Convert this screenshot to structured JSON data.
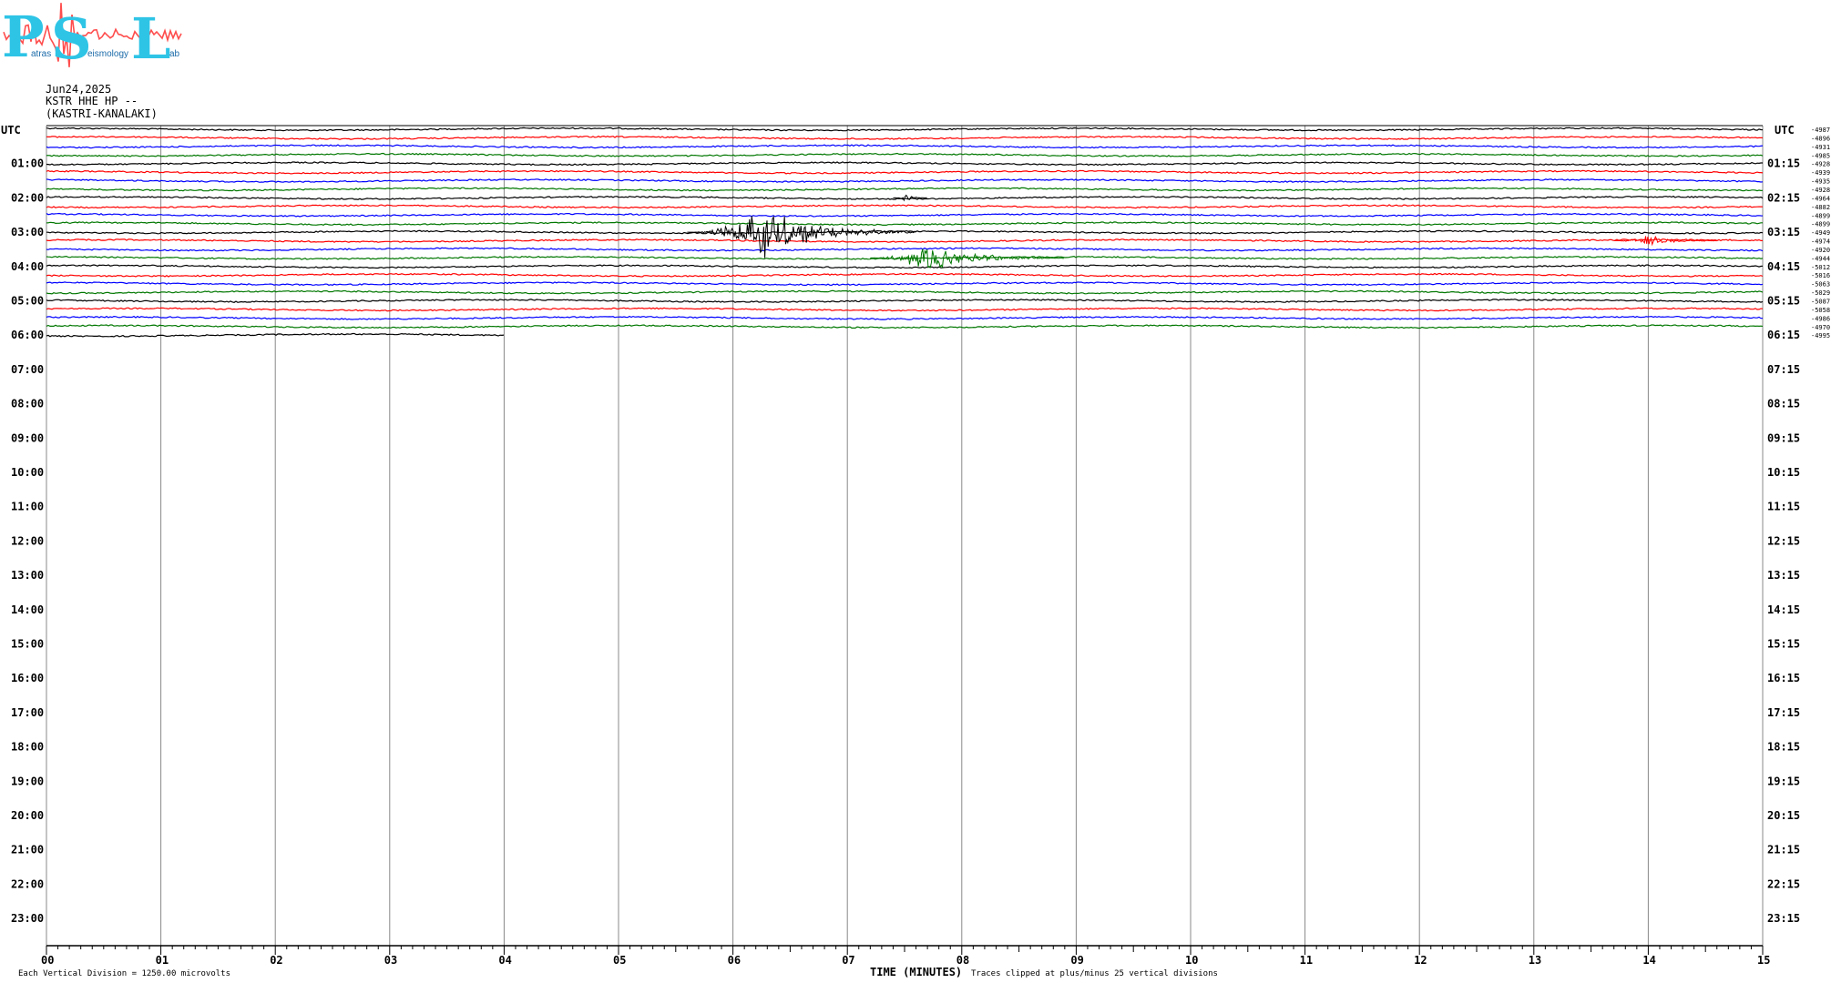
{
  "logo": {
    "letters": [
      "P",
      "S",
      "L"
    ],
    "small_texts": [
      "atras",
      "eismology",
      "ab"
    ],
    "colors": {
      "letters": "#2ec4e6",
      "trace": "#ff4d4d",
      "small_text": "#1a6aa8"
    }
  },
  "header": {
    "date": "Jun24,2025",
    "station": "KSTR HHE HP --",
    "location": "(KASTRI-KANALAKI)"
  },
  "chart_data": {
    "type": "line",
    "title": "",
    "left_axis_title": "UTC",
    "right_axis_title": "UTC",
    "left_hour_labels": [
      "01:00",
      "02:00",
      "03:00",
      "04:00",
      "05:00",
      "06:00",
      "07:00",
      "08:00",
      "09:00",
      "10:00",
      "11:00",
      "12:00",
      "13:00",
      "14:00",
      "15:00",
      "16:00",
      "17:00",
      "18:00",
      "19:00",
      "20:00",
      "21:00",
      "22:00",
      "23:00"
    ],
    "right_hour_labels": [
      "01:15",
      "02:15",
      "03:15",
      "04:15",
      "05:15",
      "06:15",
      "07:15",
      "08:15",
      "09:15",
      "10:15",
      "11:15",
      "12:15",
      "13:15",
      "14:15",
      "15:15",
      "16:15",
      "17:15",
      "18:15",
      "19:15",
      "20:15",
      "21:15",
      "22:15",
      "23:15"
    ],
    "x_tick_labels": [
      "00",
      "01",
      "02",
      "03",
      "04",
      "05",
      "06",
      "07",
      "08",
      "09",
      "10",
      "11",
      "12",
      "13",
      "14",
      "15"
    ],
    "xlim": [
      0,
      15
    ],
    "xlabel": "TIME (MINUTES)",
    "rows_per_hour": 4,
    "minutes_per_row": 15,
    "row_colors": [
      "#000000",
      "#ff0000",
      "#0000ff",
      "#007700"
    ],
    "row_offsets": [
      "-4987",
      "-4896",
      "-4931",
      "-4985",
      "-4928",
      "-4939",
      "-4935",
      "-4928",
      "-4964",
      "-4882",
      "-4899",
      "-4899",
      "-4949",
      "-4974",
      "-4920",
      "-4944",
      "-5012",
      "-5016",
      "-5063",
      "-5029",
      "-5087",
      "-5058",
      "-4986",
      "-4970",
      "-4995"
    ],
    "last_row_end_minute": 4.0,
    "events": [
      {
        "row": 12,
        "start_minute": 5.6,
        "peak_minute": 6.3,
        "end_minute": 7.6,
        "peak_amplitude": 1.0
      },
      {
        "row": 15,
        "start_minute": 7.2,
        "peak_minute": 7.7,
        "end_minute": 8.9,
        "peak_amplitude": 0.5
      },
      {
        "row": 13,
        "start_minute": 13.7,
        "peak_minute": 14.0,
        "end_minute": 14.6,
        "peak_amplitude": 0.2
      },
      {
        "row": 8,
        "start_minute": 7.4,
        "peak_minute": 7.5,
        "end_minute": 7.7,
        "peak_amplitude": 0.15
      }
    ],
    "footer_left": "Each Vertical Division = 1250.00 microvolts",
    "footer_right": "Traces clipped at plus/minus 25 vertical divisions",
    "grid": true
  }
}
